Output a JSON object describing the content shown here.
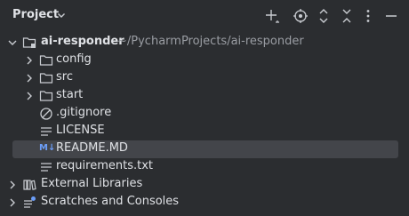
{
  "header": {
    "title": "Project"
  },
  "toolbar": {
    "icons": [
      "add-icon",
      "locate-icon",
      "expand-all-icon",
      "collapse-all-icon",
      "more-icon",
      "hide-icon"
    ]
  },
  "tree": {
    "root": {
      "label": "ai-responder",
      "path": "~/PycharmProjects/ai-responder"
    },
    "children": [
      {
        "label": "config",
        "icon": "folder-icon"
      },
      {
        "label": "src",
        "icon": "folder-icon"
      },
      {
        "label": "start",
        "icon": "folder-icon"
      },
      {
        "label": ".gitignore",
        "icon": "ignore-file-icon"
      },
      {
        "label": "LICENSE",
        "icon": "text-file-icon"
      },
      {
        "label": "README.MD",
        "icon": "markdown-file-icon",
        "badge": "M↓"
      },
      {
        "label": "requirements.txt",
        "icon": "text-file-icon"
      }
    ],
    "external_libraries": {
      "label": "External Libraries"
    },
    "scratches": {
      "label": "Scratches and Consoles"
    }
  },
  "colors": {
    "background": "#2b2d30",
    "selection": "#43454a",
    "text": "#dfe1e5",
    "path_text": "#9a9da3",
    "markdown_blue": "#6c9ef8"
  }
}
